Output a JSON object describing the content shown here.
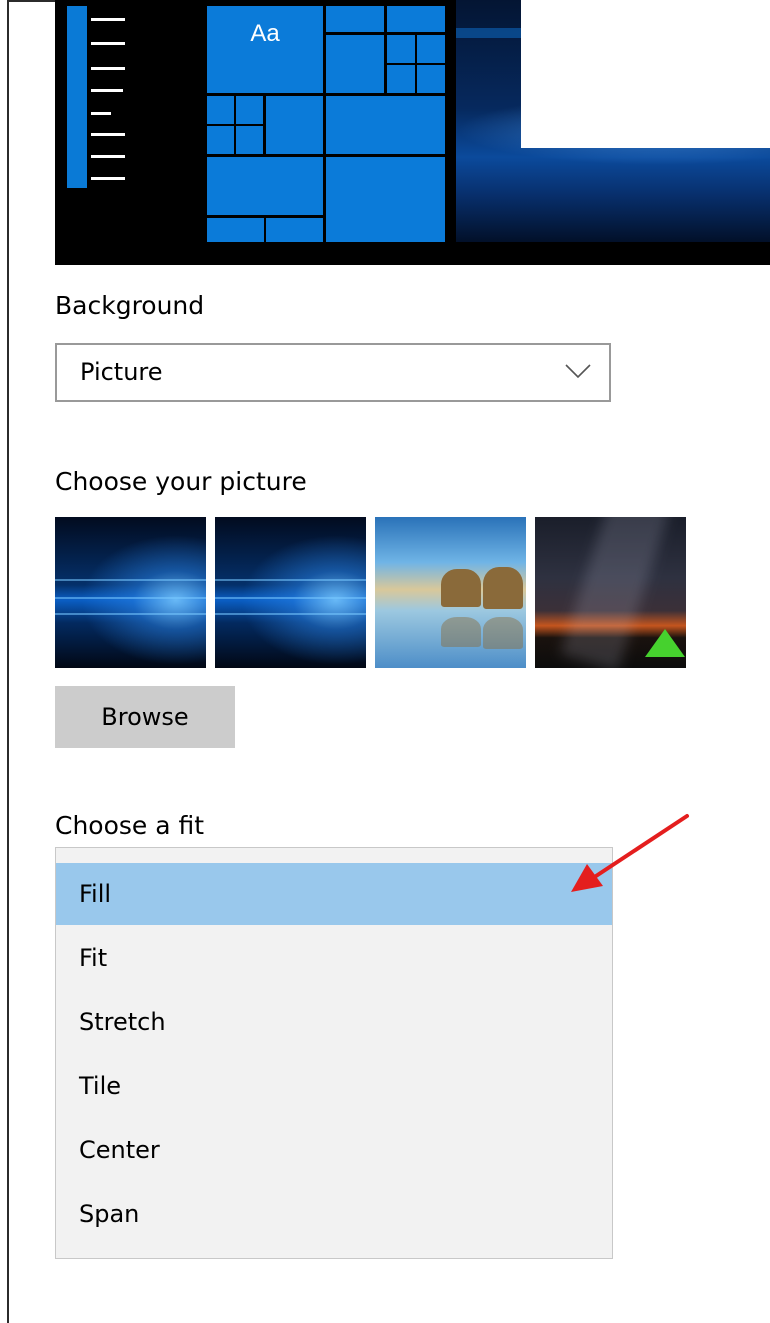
{
  "preview": {
    "tile_text": "Aa"
  },
  "background": {
    "label": "Background",
    "selected": "Picture"
  },
  "pictures": {
    "label": "Choose your picture",
    "items": [
      {
        "name": "windows-hero-1"
      },
      {
        "name": "windows-hero-2"
      },
      {
        "name": "beach-rocks"
      },
      {
        "name": "night-sky-tent"
      }
    ]
  },
  "browse": {
    "label": "Browse"
  },
  "fit": {
    "label": "Choose a fit",
    "options": [
      "Fill",
      "Fit",
      "Stretch",
      "Tile",
      "Center",
      "Span"
    ],
    "selected": "Fill"
  },
  "colors": {
    "accent": "#0B7BD9",
    "selection": "#99C8EC",
    "annotation_arrow": "#E41E1E"
  }
}
